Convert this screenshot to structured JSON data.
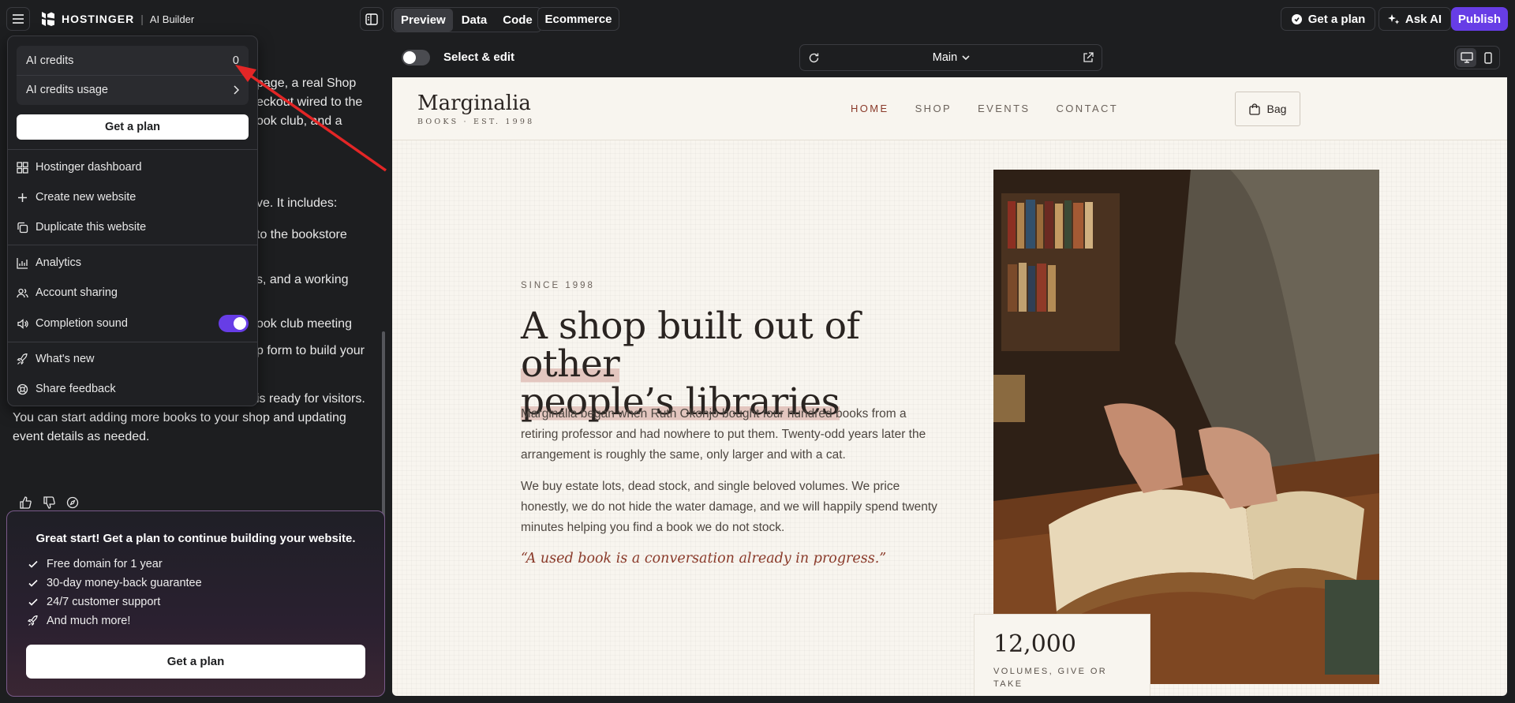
{
  "topbar": {
    "brand": "HOSTINGER",
    "separator": "|",
    "product": "AI Builder",
    "tabs": [
      {
        "label": "Preview",
        "active": true
      },
      {
        "label": "Data",
        "active": false
      },
      {
        "label": "Code",
        "active": false
      }
    ],
    "ecommerce": "Ecommerce",
    "get_plan": "Get a plan",
    "ask_ai": "Ask AI",
    "publish": "Publish",
    "accent": "#673de6"
  },
  "chat": {
    "fragments": [
      "page, a real Shop",
      "eckout wired to the",
      "ook club, and a",
      "ve. It includes:",
      "to the bookstore",
      "s, and a working",
      "ook club meeting",
      "p form to build your",
      "is ready for visitors."
    ],
    "message_lines": [
      "You can start adding more books to your shop and updating",
      "event details as needed."
    ]
  },
  "menu": {
    "credits_label": "AI credits",
    "credits_value": "0",
    "usage_label": "AI credits usage",
    "get_plan": "Get a plan",
    "items": [
      {
        "label": "Hostinger dashboard",
        "icon": "dashboard-icon"
      },
      {
        "label": "Create new website",
        "icon": "plus-icon"
      },
      {
        "label": "Duplicate this website",
        "icon": "duplicate-icon"
      },
      {
        "label": "Analytics",
        "icon": "analytics-icon"
      },
      {
        "label": "Account sharing",
        "icon": "users-icon"
      },
      {
        "label": "Completion sound",
        "icon": "speaker-icon",
        "toggle_on": true
      },
      {
        "label": "What's new",
        "icon": "rocket-icon"
      },
      {
        "label": "Share feedback",
        "icon": "feedback-icon"
      }
    ]
  },
  "promo": {
    "title": "Great start! Get a plan to continue building your website.",
    "features": [
      "Free domain for 1 year",
      "30-day money-back guarantee",
      "24/7 customer support",
      "And much more!"
    ],
    "button": "Get a plan"
  },
  "editbar": {
    "select_edit": "Select & edit",
    "page": "Main"
  },
  "site": {
    "logo_name": "Marginalia",
    "logo_tag": "BOOKS · EST. 1998",
    "nav": [
      "HOME",
      "SHOP",
      "EVENTS",
      "CONTACT"
    ],
    "bag": "Bag",
    "since": "SINCE 1998",
    "title_a": "A shop built out of ",
    "title_b": "other",
    "title_c": "people’s libraries",
    "para1": "Marginalia began when Ruth Okonjo bought four hundred books from a retiring professor and had nowhere to put them. Twenty-odd years later the arrangement is roughly the same, only larger and with a cat.",
    "para2": "We buy estate lots, dead stock, and single beloved volumes. We price honestly, we do not hide the water damage, and we will happily spend twenty minutes helping you find a book we do not stock.",
    "quote": "“A used book is a conversation already in progress.”",
    "stat_number": "12,000",
    "stat_label": "VOLUMES, GIVE OR TAKE"
  }
}
